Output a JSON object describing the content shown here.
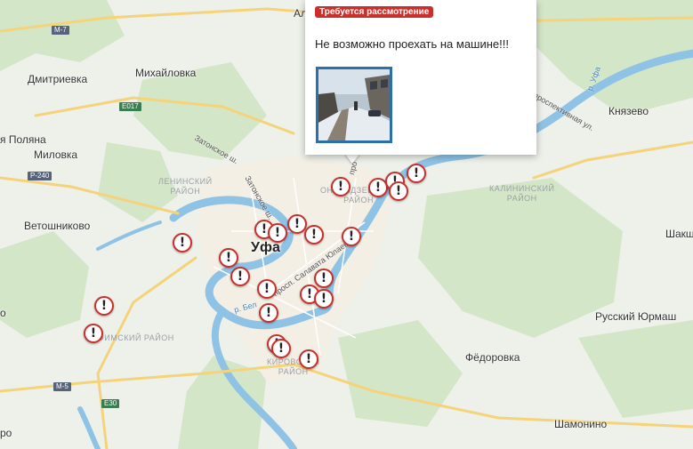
{
  "places": {
    "dmitrievka": "Дмитриевка",
    "mikhailovka": "Михайловка",
    "polyana": "я Поляна",
    "milovka": "Миловка",
    "vetoshnikovo": "Ветошниково",
    "knyazevo": "Князево",
    "shakshy": "Шакш",
    "russky_yurmash": "Русский Юрмаш",
    "fedorovka": "Фёдоровка",
    "shamonino": "Шамонино",
    "al": "Ал",
    "o_left": "о",
    "ro_left": "ро"
  },
  "city": "Уфа",
  "districts": {
    "leninsky": "ЛЕНИНСКИЙ\nРАЙОН",
    "ordzhonikidzevsky": "ОНИКИДЗЕВСКИЙ\nРАЙОН",
    "kalininsky": "КАЛИНИНСКИЙ\nРАЙОН",
    "kirovsky": "КИРОВСКИЙ\nРАЙОН",
    "ufimsky": "УФИМСКИЙ РАЙОН"
  },
  "streets": {
    "zatonskoe": "Затонское ш.",
    "zatonskoe2": "Затонское ш.",
    "salavata": "просп. Салавата Юлаева",
    "belaya": "р. Бел",
    "ufa_river": "р. Уфа",
    "prospekt": "проспективная ул.",
    "pro": "про"
  },
  "shields": {
    "m7": "М-7",
    "e017": "E017",
    "p240": "Р-240",
    "m5": "М-5",
    "e30": "E30"
  },
  "popup": {
    "badge": "Требуется рассмотрение",
    "text": "Не возможно проехать на машине!!!"
  },
  "marker_glyph": "!",
  "colors": {
    "marker_border": "#c9302c",
    "badge_bg": "#c9302c",
    "river": "#7fb8e0",
    "green": "#cfe3c4",
    "thumb_border": "#2e6fa7"
  }
}
